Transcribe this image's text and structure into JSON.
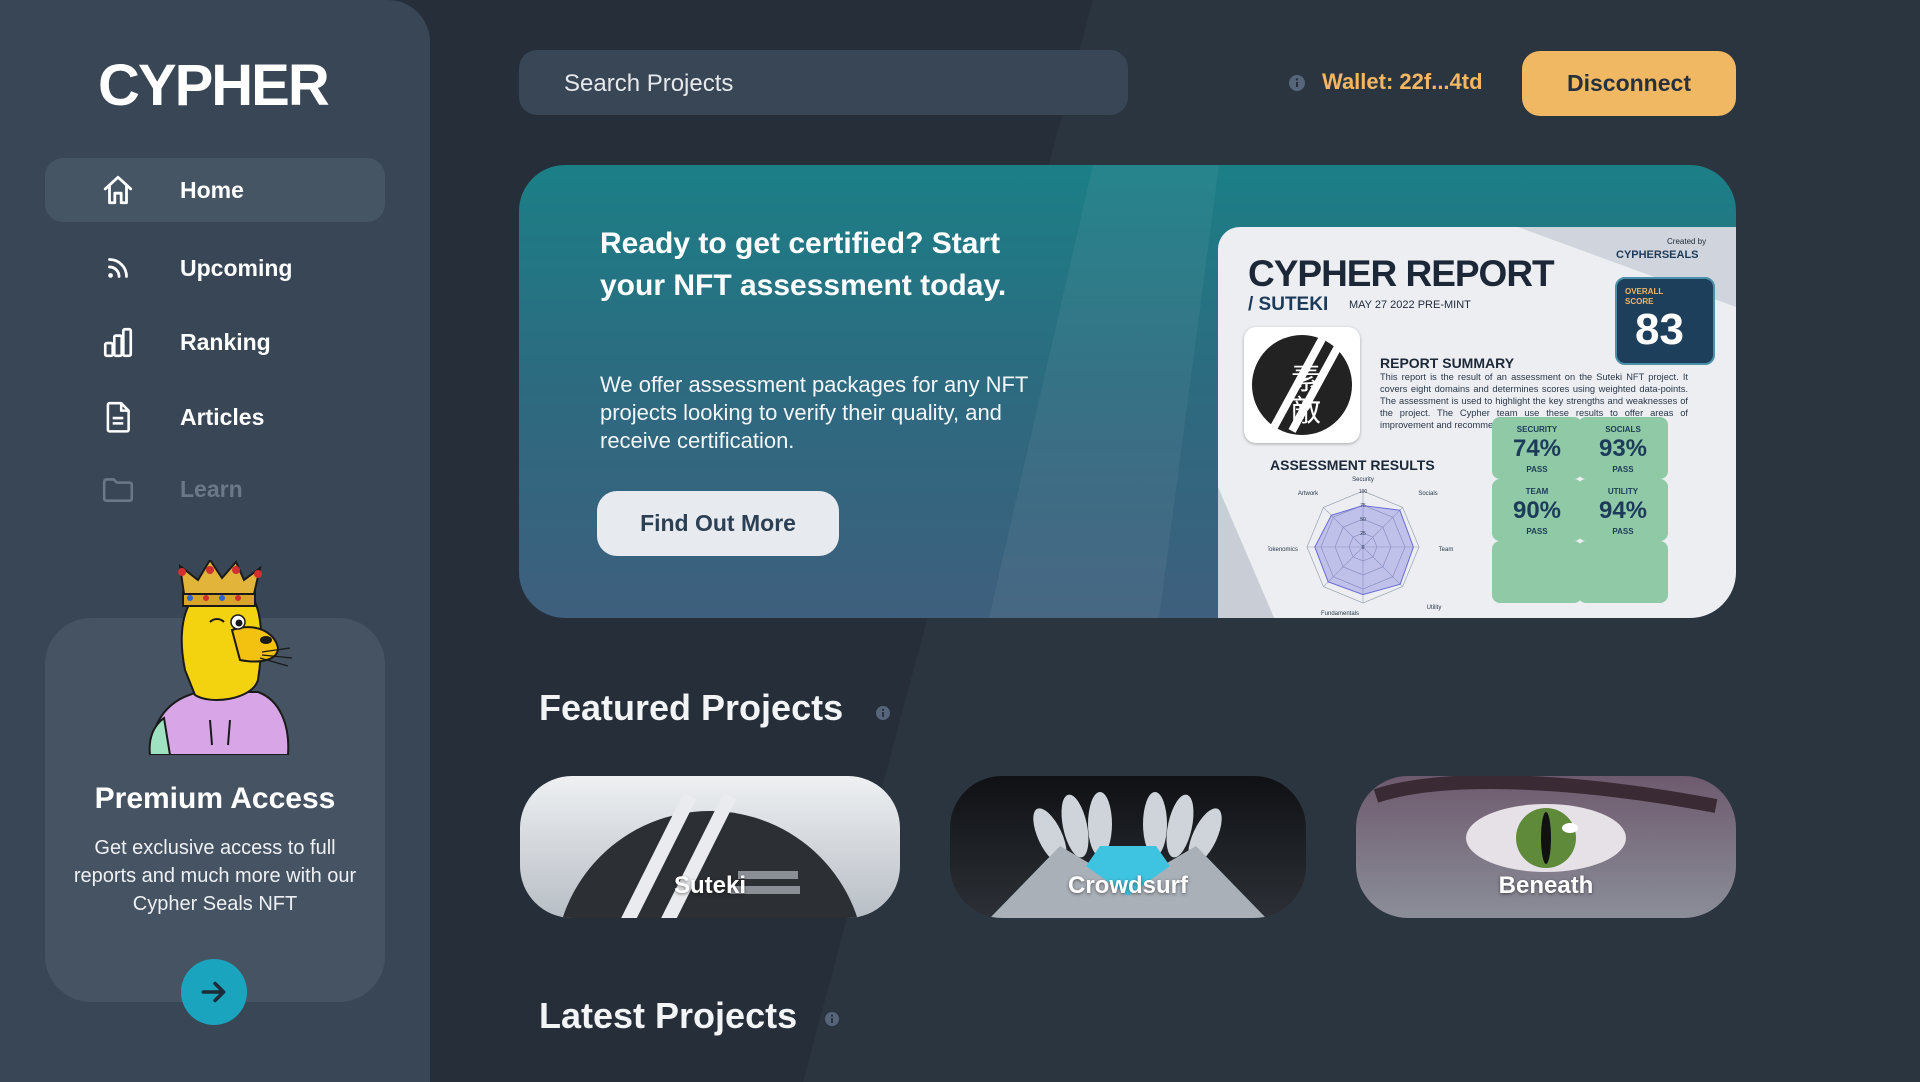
{
  "app": {
    "logo": "CYPHER"
  },
  "sidebar": {
    "items": [
      {
        "label": "Home",
        "icon": "home-icon",
        "active": true
      },
      {
        "label": "Upcoming",
        "icon": "rss-icon"
      },
      {
        "label": "Ranking",
        "icon": "bar-chart-icon"
      },
      {
        "label": "Articles",
        "icon": "document-icon"
      },
      {
        "label": "Learn",
        "icon": "folder-icon",
        "disabled": true
      }
    ],
    "premium": {
      "title": "Premium Access",
      "text": "Get exclusive access to full reports and much more with our Cypher Seals NFT"
    }
  },
  "header": {
    "search_placeholder": "Search Projects",
    "wallet": "Wallet: 22f...4td",
    "disconnect": "Disconnect"
  },
  "hero": {
    "title": "Ready to get certified? Start your NFT assessment today.",
    "text": "We offer assessment packages for any NFT projects looking to verify their quality, and receive certification.",
    "button": "Find Out More",
    "report": {
      "created_by": "Created by",
      "brand": "CYPHERSEALS",
      "title": "CYPHER REPORT",
      "subtitle": "/ SUTEKI",
      "date": "MAY 27 2022  PRE-MINT",
      "score_label": "OVERALL SCORE",
      "score": "83",
      "summary_title": "REPORT SUMMARY",
      "summary": "This report is the result of an assessment on the Suteki NFT project. It covers eight domains and determines scores using weighted data-points. The assessment is used to highlight the key strengths and weaknesses of the project. The Cypher team use these results to offer areas of improvement and recommended action to the project.",
      "assessment_title": "ASSESSMENT RESULTS",
      "radar_labels": [
        "Security",
        "Socials",
        "Team",
        "Utility",
        "Fundamentals",
        "Tokenomics",
        "Artwork"
      ],
      "radar_ticks": [
        "100",
        "75",
        "50",
        "25",
        "0"
      ],
      "badges": [
        {
          "label": "SECURITY",
          "value": "74%",
          "status": "PASS"
        },
        {
          "label": "SOCIALS",
          "value": "93%",
          "status": "PASS"
        },
        {
          "label": "TEAM",
          "value": "90%",
          "status": "PASS"
        },
        {
          "label": "UTILITY",
          "value": "94%",
          "status": "PASS"
        }
      ]
    }
  },
  "featured": {
    "title": "Featured Projects",
    "projects": [
      {
        "name": "Suteki"
      },
      {
        "name": "Crowdsurf"
      },
      {
        "name": "Beneath"
      }
    ]
  },
  "latest": {
    "title": "Latest Projects"
  },
  "colors": {
    "accent": "#f1b863",
    "teal": "#1ba4bd",
    "background": "#252e39",
    "panel": "#384655"
  }
}
